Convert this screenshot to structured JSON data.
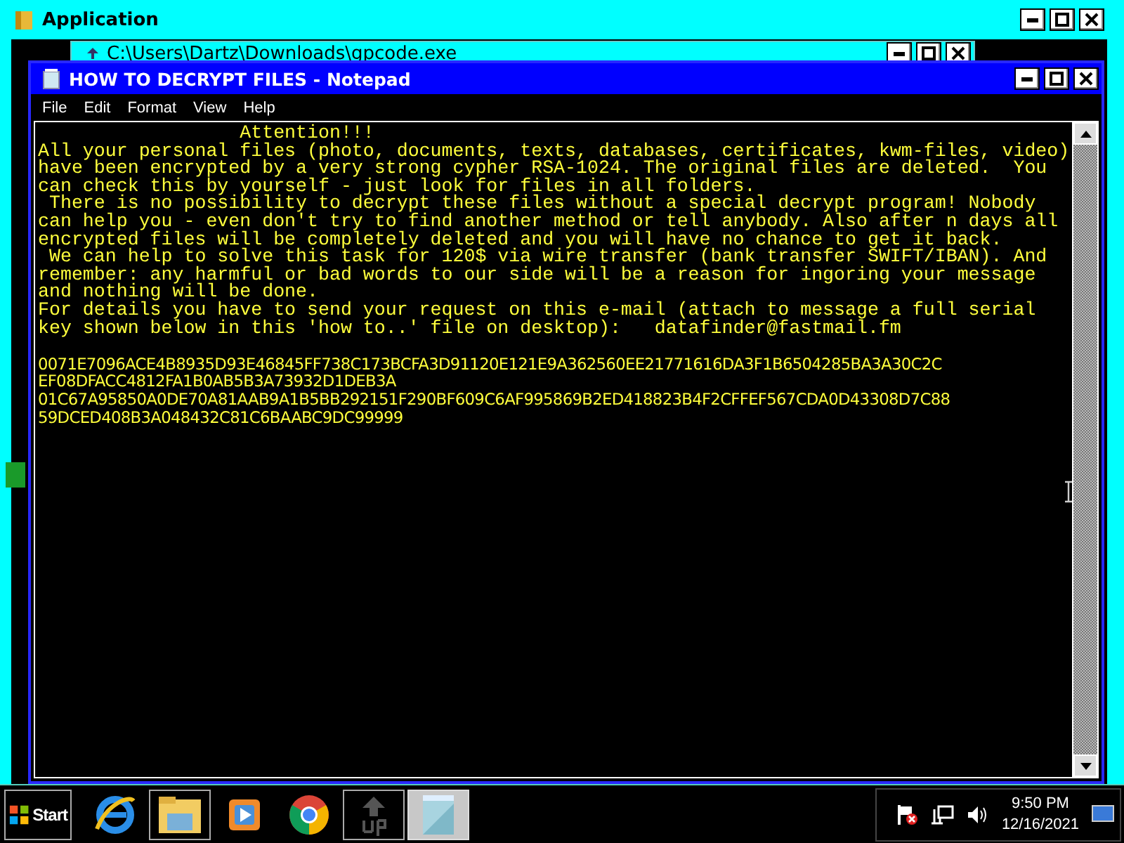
{
  "background_window": {
    "title": "Application"
  },
  "hidden_window": {
    "title": "C:\\Users\\Dartz\\Downloads\\gpcode.exe"
  },
  "notepad": {
    "title": "HOW TO DECRYPT FILES - Notepad",
    "menu": [
      "File",
      "Edit",
      "Format",
      "View",
      "Help"
    ],
    "lines": [
      {
        "kind": "text",
        "text": "                  Attention!!!"
      },
      {
        "kind": "text",
        "text": "All your personal files (photo, documents, texts, databases, certificates, kwm-files, video)"
      },
      {
        "kind": "text",
        "text": "have been encrypted by a very strong cypher RSA-1024. The original files are deleted.  You"
      },
      {
        "kind": "text",
        "text": "can check this by yourself - just look for files in all folders."
      },
      {
        "kind": "text",
        "text": " There is no possibility to decrypt these files without a special decrypt program! Nobody"
      },
      {
        "kind": "text",
        "text": "can help you - even don't try to find another method or tell anybody. Also after n days all"
      },
      {
        "kind": "text",
        "text": "encrypted files will be completely deleted and you will have no chance to get it back."
      },
      {
        "kind": "text",
        "text": " We can help to solve this task for 120$ via wire transfer (bank transfer SWIFT/IBAN). And"
      },
      {
        "kind": "text",
        "text": "remember: any harmful or bad words to our side will be a reason for ingoring your message"
      },
      {
        "kind": "text",
        "text": "and nothing will be done."
      },
      {
        "kind": "text",
        "text": "For details you have to send your request on this e-mail (attach to message a full serial"
      },
      {
        "kind": "text",
        "text": "key shown below in this 'how to..' file on desktop):   datafinder@fastmail.fm"
      },
      {
        "kind": "blank"
      },
      {
        "kind": "key",
        "text": "0071E7096ACE4B8935D93E46845FF738C173BCFA3D91120E121E9A362560EE21771616DA3F1B6504285BA3A30C2C"
      },
      {
        "kind": "key",
        "text": "EF08DFACC4812FA1B0AB5B3A73932D1DEB3A"
      },
      {
        "kind": "key",
        "text": "01C67A95850A0DE70A81AAB9A1B5BB292151F290BF609C6AF995869B2ED418823B4F2CFFEF567CDA0D43308D7C88"
      },
      {
        "kind": "key",
        "text": "59DCED408B3A048432C81C6BAABC9DC99999"
      }
    ]
  },
  "taskbar": {
    "start": "Start",
    "apps": [
      {
        "kind": "browser",
        "running": false,
        "selected": false
      },
      {
        "kind": "folder",
        "running": true,
        "selected": false
      },
      {
        "kind": "player",
        "running": false,
        "selected": false
      },
      {
        "kind": "chrome",
        "running": false,
        "selected": false
      },
      {
        "kind": "upload",
        "running": true,
        "selected": false
      },
      {
        "kind": "notepad",
        "running": true,
        "selected": true
      }
    ],
    "time": "9:50 PM",
    "date": "12/16/2021"
  }
}
